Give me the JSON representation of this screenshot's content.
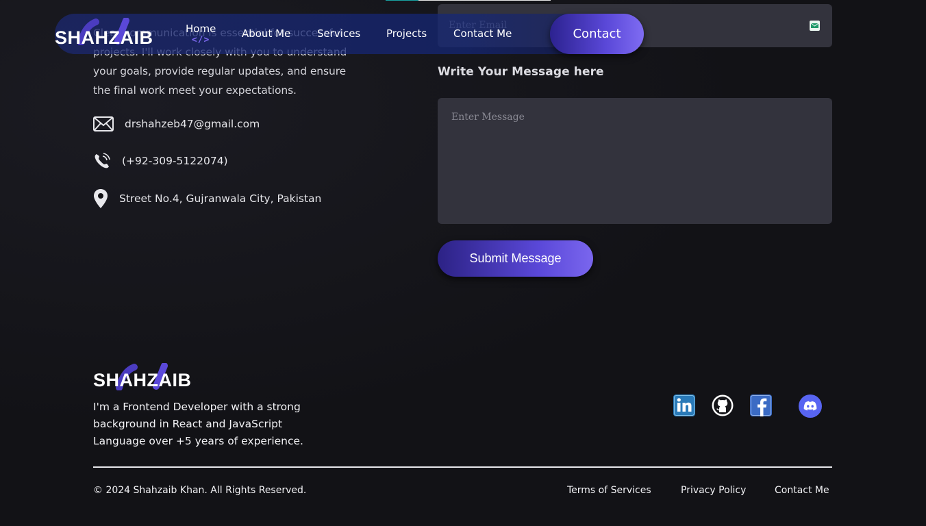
{
  "nav": {
    "brand": "SHAHZAIB",
    "links": [
      "Home",
      "About Me",
      "Services",
      "Projects",
      "Contact Me"
    ],
    "home_glyph": "</>",
    "cta": "Contact"
  },
  "contact": {
    "intro": "Clear communication is essential for successful projects. I'll work closely with you to understand your goals, provide regular updates, and ensure the final work meet your expectations.",
    "email": "drshahzeb47@gmail.com",
    "phone": "(+92-309-5122074)",
    "address": "Street No.4, Gujranwala City, Pakistan"
  },
  "form": {
    "email_placeholder": "Enter Email",
    "message_label": "Write Your Message here",
    "message_placeholder": "Enter Message",
    "submit_label": "Submit Message"
  },
  "footer": {
    "brand": "SHAHZAIB",
    "bio": "I'm a Frontend Developer with a strong background in React and JavaScript Language over +5 years of experience.",
    "social_icons": [
      "linkedin-icon",
      "github-icon",
      "facebook-icon",
      "discord-icon"
    ],
    "copyright": "© 2024 Shahzaib Khan. All Rights Reserved.",
    "links": [
      "Terms of Services",
      "Privacy Policy",
      "Contact Me"
    ]
  },
  "colors": {
    "background": "#121216",
    "accent": "#5a48d8",
    "input_bg": "#33333d",
    "nav_bg": "#1c2a78"
  }
}
